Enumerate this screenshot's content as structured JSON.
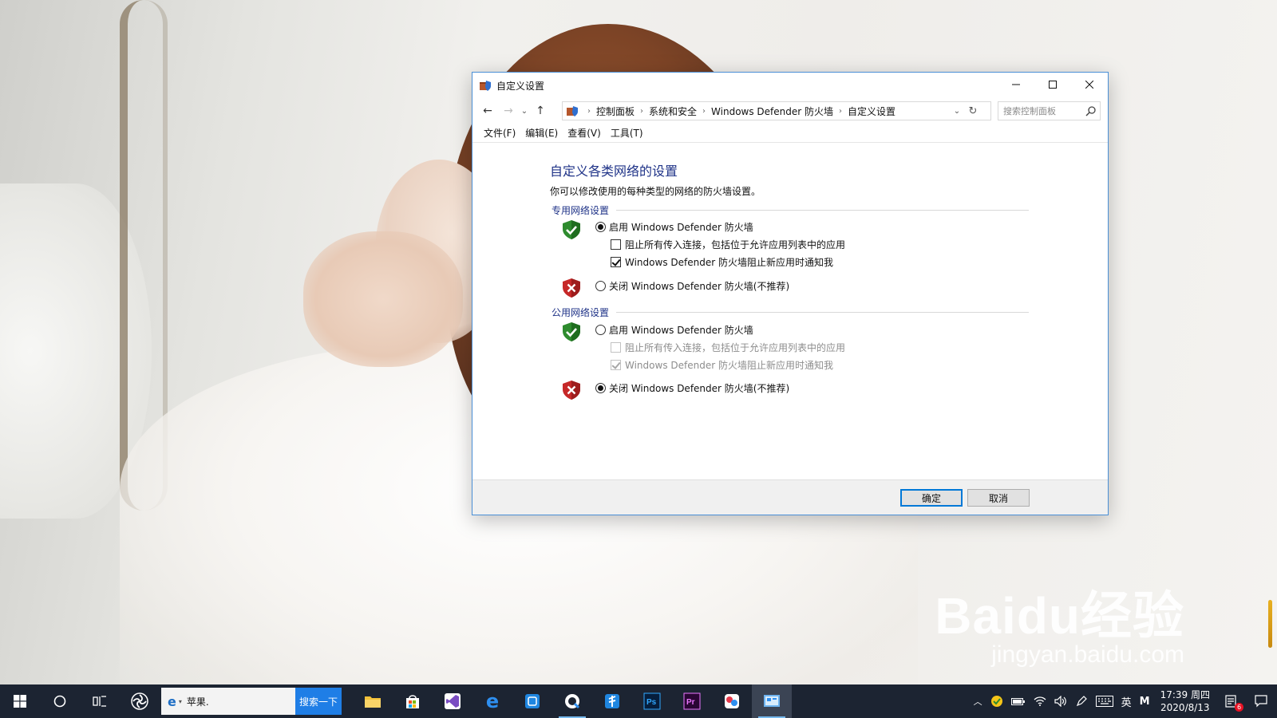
{
  "window": {
    "title": "自定义设置",
    "controls": {
      "minimize": "minimize",
      "maximize": "maximize",
      "close": "close"
    }
  },
  "address_bar": {
    "breadcrumbs": [
      "控制面板",
      "系统和安全",
      "Windows Defender 防火墙",
      "自定义设置"
    ],
    "search_placeholder": "搜索控制面板"
  },
  "menu": [
    "文件(F)",
    "编辑(E)",
    "查看(V)",
    "工具(T)"
  ],
  "main": {
    "title": "自定义各类网络的设置",
    "description": "你可以修改使用的每种类型的网络的防火墙设置。",
    "private": {
      "label": "专用网络设置",
      "enable_option": {
        "label": "启用 Windows Defender 防火墙",
        "selected": true
      },
      "block_all": {
        "label": "阻止所有传入连接，包括位于允许应用列表中的应用",
        "checked": false,
        "disabled": false
      },
      "notify": {
        "label": "Windows Defender 防火墙阻止新应用时通知我",
        "checked": true,
        "disabled": false
      },
      "disable_option": {
        "label": "关闭 Windows Defender 防火墙(不推荐)",
        "selected": false
      }
    },
    "public": {
      "label": "公用网络设置",
      "enable_option": {
        "label": "启用 Windows Defender 防火墙",
        "selected": false
      },
      "block_all": {
        "label": "阻止所有传入连接，包括位于允许应用列表中的应用",
        "checked": false,
        "disabled": true
      },
      "notify": {
        "label": "Windows Defender 防火墙阻止新应用时通知我",
        "checked": true,
        "disabled": true
      },
      "disable_option": {
        "label": "关闭 Windows Defender 防火墙(不推荐)",
        "selected": true
      }
    }
  },
  "buttons": {
    "ok": "确定",
    "cancel": "取消"
  },
  "taskbar": {
    "search_query": "苹果.",
    "search_button": "搜索一下",
    "apps": [
      "file-explorer",
      "store",
      "visual-studio",
      "edge",
      "app-5",
      "app-6",
      "app-7",
      "photoshop",
      "premiere",
      "app-10",
      "control-panel"
    ],
    "tray": {
      "ime": "英",
      "ime2": "M",
      "time": "17:39 周四",
      "date": "2020/8/13",
      "notification_count": "6"
    }
  },
  "watermark": {
    "brand": "Baidu经验",
    "url": "jingyan.baidu.com"
  },
  "colors": {
    "accent": "#0078d7",
    "title_blue": "#1e3287",
    "shield_green": "#2e8b2e",
    "shield_red": "#c62828",
    "taskbar": "#1c2432"
  }
}
